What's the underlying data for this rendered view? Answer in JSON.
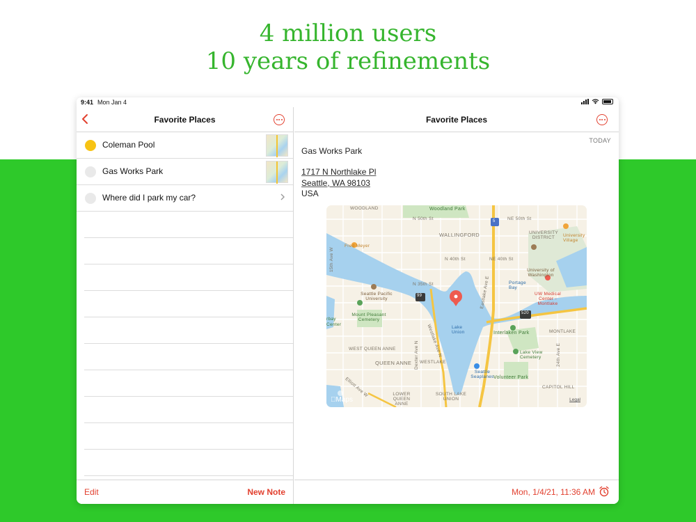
{
  "headline": {
    "line1": "4 million users",
    "line2": "10 years of refinements"
  },
  "status_bar": {
    "time": "9:41",
    "date": "Mon Jan 4"
  },
  "sidebar": {
    "title": "Favorite Places",
    "items": [
      {
        "label": "Coleman Pool",
        "done": false,
        "color": "#f7c314",
        "has_map": true
      },
      {
        "label": "Gas Works Park",
        "done": false,
        "has_map": true
      },
      {
        "label": "Where did I park my car?",
        "done": false,
        "has_map": false
      }
    ],
    "edit_label": "Edit",
    "new_note_label": "New Note"
  },
  "detail": {
    "title": "Favorite Places",
    "today_label": "TODAY",
    "note_title": "Gas Works Park",
    "address": {
      "line1": "1717 N Northlake Pl",
      "line2": "Seattle, WA 98103",
      "line3": "USA"
    },
    "timestamp": "Mon, 1/4/21, 11:36 AM",
    "map": {
      "labels": [
        "WOODLAND",
        "Woodland Park",
        "N 50th St",
        "NE 50th St",
        "WALLINGFORD",
        "UNIVERSITY DISTRICT",
        "University Village",
        "Fred Meyer",
        "N 40th St",
        "NE 40th St",
        "University of Washington",
        "Portage Bay",
        "N 35th St",
        "Seattle Pacific University",
        "UW Medical Center - Montlake",
        "Lake Union",
        "Mount Pleasant Cemetery",
        "Interlaken Park",
        "MONTLAKE",
        "WEST QUEEN ANNE",
        "QUEEN ANNE",
        "Lake View Cemetery",
        "WESTLAKE",
        "Seattle Seaplanes",
        "Volunteer Park",
        "CAPITOL HILL",
        "LOWER QUEEN ANNE",
        "SOUTH LAKE UNION",
        "15th Ave W",
        "Eastlake Ave E",
        "Westlake Ave N",
        "Elliott Ave W",
        "24th Ave E",
        "Dexter Ave N",
        "5",
        "99",
        "520",
        "Maps",
        "Legal",
        "rbay",
        "Center"
      ]
    }
  },
  "colors": {
    "accent": "#e2402f",
    "brand_green": "#2ec92a",
    "headline_green": "#36b52e"
  }
}
